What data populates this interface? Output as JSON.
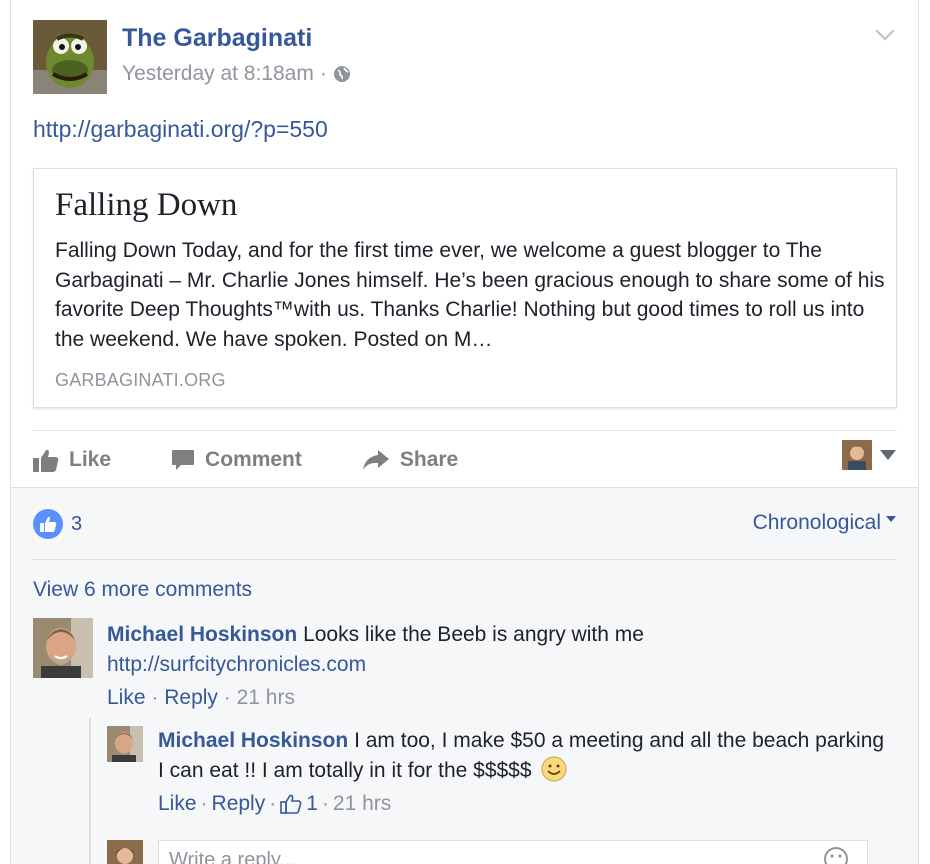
{
  "post": {
    "page_name": "The Garbaginati",
    "timestamp": "Yesterday at 8:18am",
    "separator": "·",
    "link_text": "http://garbaginati.org/?p=550",
    "preview": {
      "title": "Falling Down",
      "description": "Falling Down Today, and for the first time ever, we welcome a guest blogger to The Garbaginati – Mr. Charlie Jones himself. He’s been gracious enough to share some of his favorite Deep Thoughts™with us. Thanks Charlie! Nothing but good times to roll us into the weekend. We have spoken. Posted on M…",
      "domain": "GARBAGINATI.ORG"
    }
  },
  "actions": {
    "like": "Like",
    "comment": "Comment",
    "share": "Share"
  },
  "reactions": {
    "count": "3",
    "order_label": "Chronological"
  },
  "comments": {
    "view_more": "View 6 more comments",
    "items": [
      {
        "author": "Michael Hoskinson",
        "text": "Looks like the Beeb is angry with me",
        "link": "http://surfcitychronicles.com",
        "like": "Like",
        "reply": "Reply",
        "time": "21 hrs"
      },
      {
        "author": "Michael Hoskinson",
        "text": "I am too, I make $50 a meeting and all the beach parking I can eat !! I am totally in it for the $$$$$",
        "like": "Like",
        "reply": "Reply",
        "likes": "1",
        "time": "21 hrs"
      }
    ],
    "reply_placeholder": "Write a reply..."
  },
  "colors": {
    "link_blue": "#365899",
    "muted_gray": "#90949c",
    "like_bubble": "#5890ff",
    "comments_bg": "#f6f7f9"
  }
}
